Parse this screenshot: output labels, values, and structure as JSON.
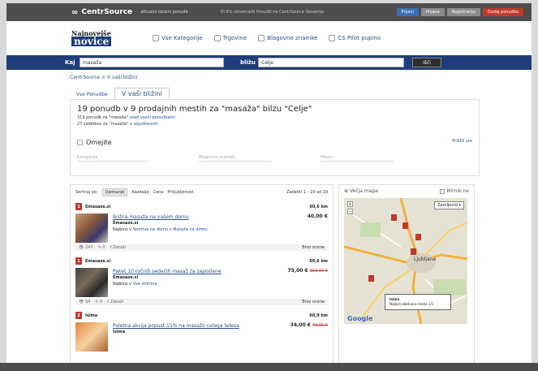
{
  "topbar": {
    "logo": "CentrSource",
    "logo_sub": "aktualni lokalni ponudb",
    "info": "Ol 6% slovenskih Ponudb na CentrSource Slovenija",
    "btn_login": "Prijavi",
    "btn_2": "Prijava",
    "btn_3": "Registracija",
    "btn_4": "Dodaj ponudbo"
  },
  "brand": {
    "line1": "Najnovejše",
    "line2": "novice"
  },
  "nav": [
    {
      "label": "Vse Kategorije"
    },
    {
      "label": "Trgovine"
    },
    {
      "label": "Blagovne znamke"
    },
    {
      "label": "CS Pilot pupino"
    }
  ],
  "search": {
    "what_label": "Kaj",
    "what_value": "masaža",
    "where_label": "bližu",
    "where_value": "Celje",
    "button": "Išči"
  },
  "breadcrumb": "CentrSource > V vaši bližini",
  "tabs": {
    "all": "Vse Ponudbe",
    "near": "V vaši bližini"
  },
  "results": {
    "title": "19 ponudb v 9 prodajnih mestih za \"masaža\" bilzu \"Celje\"",
    "line1_prefix": "319 ponudb za \"masaža\"",
    "line1_link": "vsed vseni ponudbami",
    "line2_prefix": "27 zadetkov za \"masaža\" v",
    "line2_link": "sojudnevnih",
    "narrow": "Omejite",
    "more": "Približ ure",
    "filters": [
      "Kategorija",
      "Blagovne znamke",
      "Mesto"
    ]
  },
  "sort": {
    "label": "Sortiraj po:",
    "options": [
      "Ujemanje",
      "Razdalja",
      "Cena",
      "Priljubljenost"
    ],
    "count": "Zadetki 1 - 19 od 19"
  },
  "offers": [
    {
      "pin": "1",
      "merchant": "Emasaze.si",
      "distance": "60,6 km",
      "title": "Božna masaža na vašem domu",
      "store": "Emasaze.si",
      "location_prefix": "Najbinz v",
      "location_link": "Storitve na domu v Masaža na domu",
      "price": "40,00 €",
      "old_price": "",
      "stats": [
        "247",
        "0",
        "Zakaži"
      ],
      "right": "Brez ocene"
    },
    {
      "pin": "1",
      "merchant": "Emasaze.si",
      "distance": "60,6 km",
      "title": "Paket 10 ročnih sedečih masaž za zaposlene",
      "store": "Emasaze.si",
      "location_prefix": "Najbinz v",
      "location_link": "Vse storitve",
      "price": "75,00 €",
      "old_price": "150,00 €",
      "stats": [
        "54",
        "0",
        "Zakaži"
      ],
      "right": "Brez ocene"
    },
    {
      "pin": "2",
      "merchant": "Isima",
      "distance": "60,9 km",
      "title": "Poletna akcija popust 15% na masažo celega telesa",
      "store": "Isima",
      "location_prefix": "",
      "location_link": "",
      "price": "34,00 €",
      "old_price": "40,00 €",
      "stats": [],
      "right": ""
    }
  ],
  "map": {
    "title": "Večja mapa",
    "checkbox_label": "Mirnik ne",
    "select": "Zemljevid",
    "popup_title": "Isima",
    "popup_text": "Najbolj obiskana mesta 1/1",
    "city": "Ljubljana",
    "google": "Google"
  },
  "colors": {
    "nav_blue": "#1f3d7a",
    "pin_red": "#c0392b",
    "dark_bar": "#4d4d4d"
  }
}
